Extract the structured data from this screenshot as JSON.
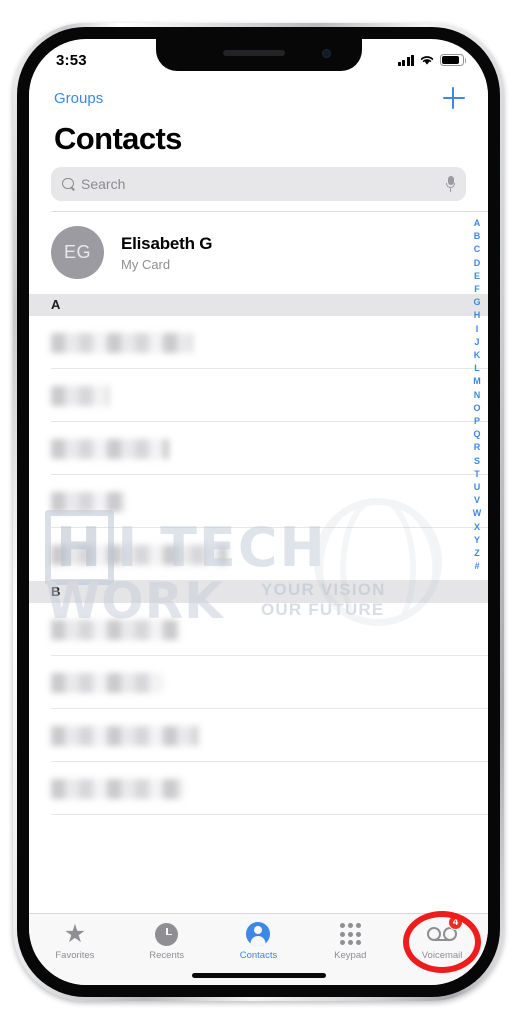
{
  "status_bar": {
    "time": "3:53",
    "signal_icon": "cellular-signal-icon",
    "wifi_icon": "wifi-icon",
    "battery_icon": "battery-icon"
  },
  "nav_bar": {
    "groups_label": "Groups",
    "add_icon": "plus-icon"
  },
  "page": {
    "title": "Contacts"
  },
  "search": {
    "placeholder": "Search",
    "value": "",
    "search_icon": "search-icon",
    "dictation_icon": "microphone-icon"
  },
  "my_card": {
    "initials": "EG",
    "name": "Elisabeth G",
    "subtitle": "My Card"
  },
  "sections": [
    {
      "letter": "A",
      "rows": [
        {
          "name": "",
          "blur_width": 142
        },
        {
          "name": "",
          "blur_width": 58
        },
        {
          "name": "",
          "blur_width": 118
        },
        {
          "name": "",
          "blur_width": 74
        },
        {
          "name": "",
          "blur_width": 176
        }
      ]
    },
    {
      "letter": "B",
      "rows": [
        {
          "name": "",
          "blur_width": 128
        },
        {
          "name": "",
          "blur_width": 112
        },
        {
          "name": "",
          "blur_width": 148
        },
        {
          "name": "",
          "blur_width": 132
        }
      ]
    }
  ],
  "index_letters": [
    "A",
    "B",
    "C",
    "D",
    "E",
    "F",
    "G",
    "H",
    "I",
    "J",
    "K",
    "L",
    "M",
    "N",
    "O",
    "P",
    "Q",
    "R",
    "S",
    "T",
    "U",
    "V",
    "W",
    "X",
    "Y",
    "Z",
    "#"
  ],
  "watermark": {
    "line1_prefix": "H",
    "line1": "I TECH",
    "line2": "WORK",
    "tagline_1": "YOUR VISION",
    "tagline_2": "OUR FUTURE"
  },
  "tab_bar": {
    "tabs": [
      {
        "label": "Favorites",
        "icon": "star-icon",
        "active": false
      },
      {
        "label": "Recents",
        "icon": "clock-icon",
        "active": false
      },
      {
        "label": "Contacts",
        "icon": "person-circle-icon",
        "active": true
      },
      {
        "label": "Keypad",
        "icon": "keypad-dots-icon",
        "active": false
      },
      {
        "label": "Voicemail",
        "icon": "voicemail-icon",
        "active": false,
        "badge": "4"
      }
    ]
  },
  "annotation": {
    "shape": "red-ellipse-highlight",
    "target": "Voicemail",
    "color": "#ef1c1c"
  },
  "colors": {
    "accent_blue": "#3c87e8",
    "badge_red": "#f02d20",
    "section_header_bg": "#e5e5e7",
    "search_bg": "#e7e7ea",
    "tabbar_bg": "#f8f8f9"
  }
}
